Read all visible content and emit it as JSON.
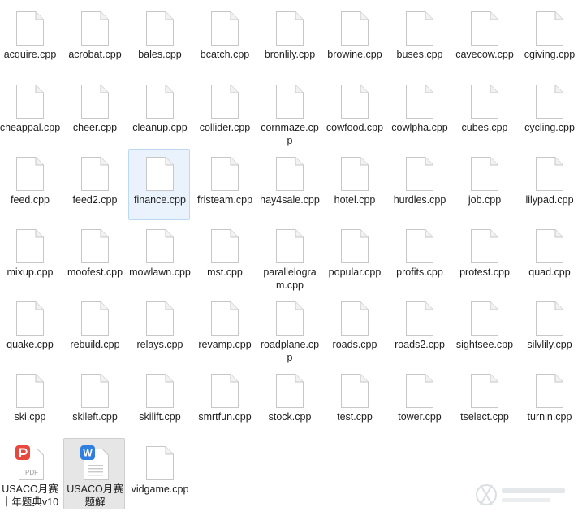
{
  "files": [
    {
      "name": "acquire.cpp",
      "type": "cpp"
    },
    {
      "name": "acrobat.cpp",
      "type": "cpp"
    },
    {
      "name": "bales.cpp",
      "type": "cpp"
    },
    {
      "name": "bcatch.cpp",
      "type": "cpp"
    },
    {
      "name": "bronlily.cpp",
      "type": "cpp"
    },
    {
      "name": "browine.cpp",
      "type": "cpp"
    },
    {
      "name": "buses.cpp",
      "type": "cpp"
    },
    {
      "name": "cavecow.cpp",
      "type": "cpp"
    },
    {
      "name": "cgiving.cpp",
      "type": "cpp"
    },
    {
      "name": "cheappal.cpp",
      "type": "cpp"
    },
    {
      "name": "cheer.cpp",
      "type": "cpp"
    },
    {
      "name": "cleanup.cpp",
      "type": "cpp"
    },
    {
      "name": "collider.cpp",
      "type": "cpp"
    },
    {
      "name": "cornmaze.cpp",
      "type": "cpp"
    },
    {
      "name": "cowfood.cpp",
      "type": "cpp"
    },
    {
      "name": "cowlpha.cpp",
      "type": "cpp"
    },
    {
      "name": "cubes.cpp",
      "type": "cpp"
    },
    {
      "name": "cycling.cpp",
      "type": "cpp"
    },
    {
      "name": "feed.cpp",
      "type": "cpp"
    },
    {
      "name": "feed2.cpp",
      "type": "cpp"
    },
    {
      "name": "finance.cpp",
      "type": "cpp",
      "selected": true
    },
    {
      "name": "fristeam.cpp",
      "type": "cpp"
    },
    {
      "name": "hay4sale.cpp",
      "type": "cpp"
    },
    {
      "name": "hotel.cpp",
      "type": "cpp"
    },
    {
      "name": "hurdles.cpp",
      "type": "cpp"
    },
    {
      "name": "job.cpp",
      "type": "cpp"
    },
    {
      "name": "lilypad.cpp",
      "type": "cpp"
    },
    {
      "name": "mixup.cpp",
      "type": "cpp"
    },
    {
      "name": "moofest.cpp",
      "type": "cpp"
    },
    {
      "name": "mowlawn.cpp",
      "type": "cpp"
    },
    {
      "name": "mst.cpp",
      "type": "cpp"
    },
    {
      "name": "parallelogram.cpp",
      "type": "cpp"
    },
    {
      "name": "popular.cpp",
      "type": "cpp"
    },
    {
      "name": "profits.cpp",
      "type": "cpp"
    },
    {
      "name": "protest.cpp",
      "type": "cpp"
    },
    {
      "name": "quad.cpp",
      "type": "cpp"
    },
    {
      "name": "quake.cpp",
      "type": "cpp"
    },
    {
      "name": "rebuild.cpp",
      "type": "cpp"
    },
    {
      "name": "relays.cpp",
      "type": "cpp"
    },
    {
      "name": "revamp.cpp",
      "type": "cpp"
    },
    {
      "name": "roadplane.cpp",
      "type": "cpp"
    },
    {
      "name": "roads.cpp",
      "type": "cpp"
    },
    {
      "name": "roads2.cpp",
      "type": "cpp"
    },
    {
      "name": "sightsee.cpp",
      "type": "cpp"
    },
    {
      "name": "silvlily.cpp",
      "type": "cpp"
    },
    {
      "name": "ski.cpp",
      "type": "cpp"
    },
    {
      "name": "skileft.cpp",
      "type": "cpp"
    },
    {
      "name": "skilift.cpp",
      "type": "cpp"
    },
    {
      "name": "smrtfun.cpp",
      "type": "cpp"
    },
    {
      "name": "stock.cpp",
      "type": "cpp"
    },
    {
      "name": "test.cpp",
      "type": "cpp"
    },
    {
      "name": "tower.cpp",
      "type": "cpp"
    },
    {
      "name": "tselect.cpp",
      "type": "cpp"
    },
    {
      "name": "turnin.cpp",
      "type": "cpp"
    },
    {
      "name": "USACO月赛十年题典v10",
      "type": "pdf"
    },
    {
      "name": "USACO月赛题解",
      "type": "word",
      "active": true
    },
    {
      "name": "vidgame.cpp",
      "type": "cpp"
    }
  ],
  "icon_labels": {
    "pdf": "PDF",
    "word": "W"
  },
  "colors": {
    "pdf_red": "#e8483d",
    "word_blue": "#2f7fe0",
    "page_border": "#c7c7c7",
    "selection_bg": "#eaf3fc",
    "selection_border": "#bcd8f2"
  }
}
